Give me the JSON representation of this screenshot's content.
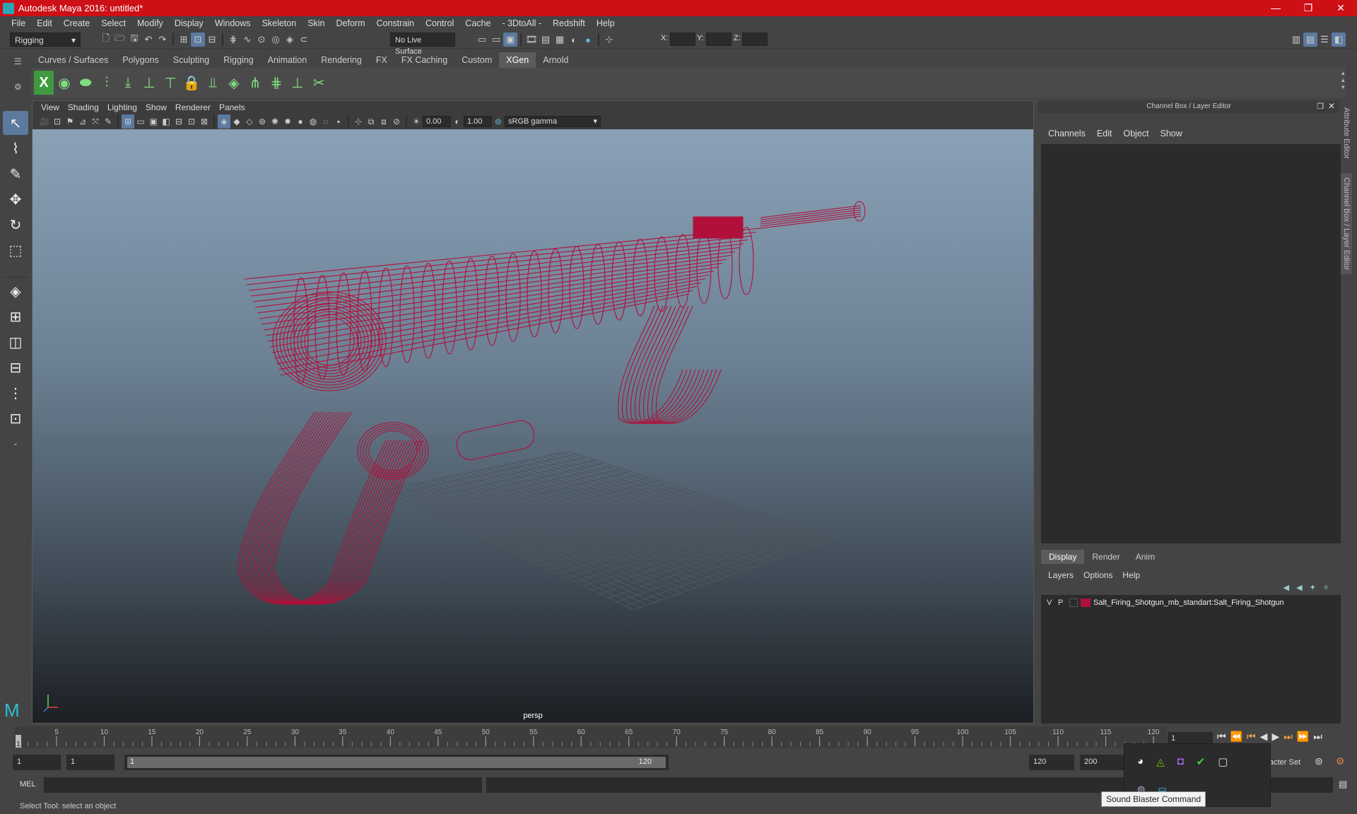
{
  "window": {
    "title": "Autodesk Maya 2016: untitled*",
    "min": "—",
    "max": "❐",
    "close": "✕"
  },
  "menubar": [
    "File",
    "Edit",
    "Create",
    "Select",
    "Modify",
    "Display",
    "Windows",
    "Skeleton",
    "Skin",
    "Deform",
    "Constrain",
    "Control",
    "Cache",
    "- 3DtoAll -",
    "Redshift",
    "Help"
  ],
  "statusline": {
    "mode": "Rigging",
    "live_surface": "No Live Surface",
    "x_label": "X:",
    "y_label": "Y:",
    "z_label": "Z:"
  },
  "shelf_tabs": [
    "Curves / Surfaces",
    "Polygons",
    "Sculpting",
    "Rigging",
    "Animation",
    "Rendering",
    "FX",
    "FX Caching",
    "Custom",
    "XGen",
    "Arnold"
  ],
  "shelf_active": "XGen",
  "viewport": {
    "menu": [
      "View",
      "Shading",
      "Lighting",
      "Show",
      "Renderer",
      "Panels"
    ],
    "exposure": "0.00",
    "gamma": "1.00",
    "colorspace": "sRGB gamma",
    "camera": "persp",
    "model_color": "#b0103a"
  },
  "channel_box": {
    "title": "Channel Box / Layer Editor",
    "menu": [
      "Channels",
      "Edit",
      "Object",
      "Show"
    ]
  },
  "layer_editor": {
    "tabs": [
      "Display",
      "Render",
      "Anim"
    ],
    "active_tab": "Display",
    "menu": [
      "Layers",
      "Options",
      "Help"
    ],
    "layers": [
      {
        "v": "V",
        "p": "P",
        "color": "#b0103a",
        "name": "Salt_Firing_Shotgun_mb_standart:Salt_Firing_Shotgun"
      }
    ]
  },
  "side_tabs": [
    "Attribute Editor",
    "Channel Box / Layer Editor"
  ],
  "timeline": {
    "ticks": [
      1,
      5,
      10,
      15,
      20,
      25,
      30,
      35,
      40,
      45,
      50,
      55,
      60,
      65,
      70,
      75,
      80,
      85,
      90,
      95,
      100,
      105,
      110,
      115,
      120
    ],
    "current_frame": "1",
    "current_field": "1"
  },
  "range": {
    "start": "1",
    "start_inner": "1",
    "slider_start": "1",
    "slider_end": "120",
    "end_inner": "120",
    "end": "200",
    "character_set": "acter Set"
  },
  "cmdline": {
    "label": "MEL"
  },
  "helpline": "Select Tool: select an object",
  "tooltip": "Sound Blaster Command"
}
